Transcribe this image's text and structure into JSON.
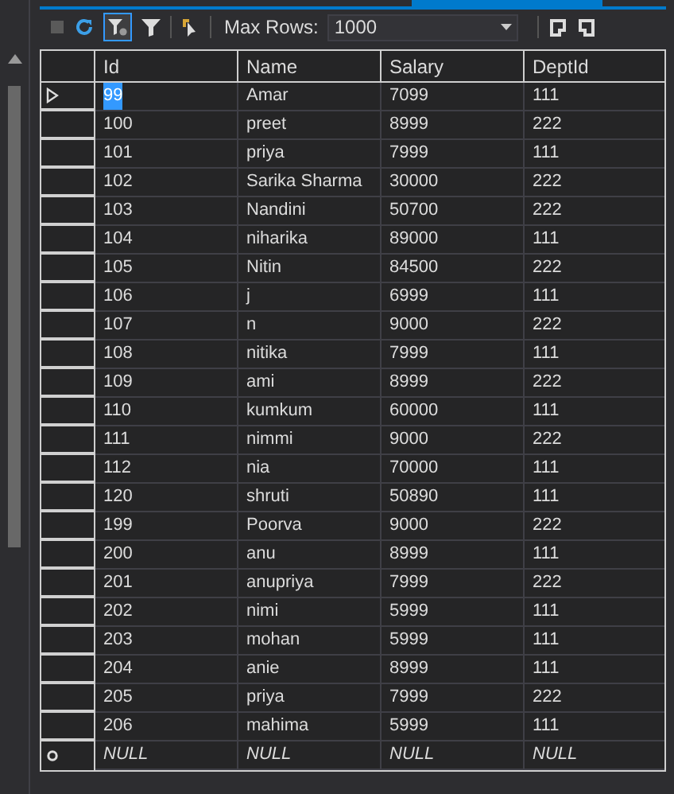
{
  "toolbar": {
    "filter_selected": true,
    "max_rows_label": "Max Rows:",
    "max_rows_value": "1000"
  },
  "table": {
    "columns": [
      "Id",
      "Name",
      "Salary",
      "DeptId"
    ],
    "rows": [
      {
        "kind": "data",
        "current": true,
        "cells": [
          "99",
          "Amar",
          "7099",
          "111"
        ]
      },
      {
        "kind": "data",
        "current": false,
        "cells": [
          "100",
          "preet",
          "8999",
          "222"
        ]
      },
      {
        "kind": "data",
        "current": false,
        "cells": [
          "101",
          "priya",
          "7999",
          "111"
        ]
      },
      {
        "kind": "data",
        "current": false,
        "cells": [
          "102",
          "Sarika Sharma",
          "30000",
          "222"
        ]
      },
      {
        "kind": "data",
        "current": false,
        "cells": [
          "103",
          "Nandini",
          "50700",
          "222"
        ]
      },
      {
        "kind": "data",
        "current": false,
        "cells": [
          "104",
          "niharika",
          "89000",
          "111"
        ]
      },
      {
        "kind": "data",
        "current": false,
        "cells": [
          "105",
          "Nitin",
          "84500",
          "222"
        ]
      },
      {
        "kind": "data",
        "current": false,
        "cells": [
          "106",
          "j",
          "6999",
          "111"
        ]
      },
      {
        "kind": "data",
        "current": false,
        "cells": [
          "107",
          "n",
          "9000",
          "222"
        ]
      },
      {
        "kind": "data",
        "current": false,
        "cells": [
          "108",
          "nitika",
          "7999",
          "111"
        ]
      },
      {
        "kind": "data",
        "current": false,
        "cells": [
          "109",
          "ami",
          "8999",
          "222"
        ]
      },
      {
        "kind": "data",
        "current": false,
        "cells": [
          "110",
          "kumkum",
          "60000",
          "111"
        ]
      },
      {
        "kind": "data",
        "current": false,
        "cells": [
          "111",
          "nimmi",
          "9000",
          "222"
        ]
      },
      {
        "kind": "data",
        "current": false,
        "cells": [
          "112",
          "nia",
          "70000",
          "111"
        ]
      },
      {
        "kind": "data",
        "current": false,
        "cells": [
          "120",
          "shruti",
          "50890",
          "111"
        ]
      },
      {
        "kind": "data",
        "current": false,
        "cells": [
          "199",
          "Poorva",
          "9000",
          "222"
        ]
      },
      {
        "kind": "data",
        "current": false,
        "cells": [
          "200",
          "anu",
          "8999",
          "111"
        ]
      },
      {
        "kind": "data",
        "current": false,
        "cells": [
          "201",
          "anupriya",
          "7999",
          "222"
        ]
      },
      {
        "kind": "data",
        "current": false,
        "cells": [
          "202",
          "nimi",
          "5999",
          "111"
        ]
      },
      {
        "kind": "data",
        "current": false,
        "cells": [
          "203",
          "mohan",
          "5999",
          "111"
        ]
      },
      {
        "kind": "data",
        "current": false,
        "cells": [
          "204",
          "anie",
          "8999",
          "111"
        ]
      },
      {
        "kind": "data",
        "current": false,
        "cells": [
          "205",
          "priya",
          "7999",
          "222"
        ]
      },
      {
        "kind": "data",
        "current": false,
        "cells": [
          "206",
          "mahima",
          "5999",
          "111"
        ]
      },
      {
        "kind": "new",
        "current": false,
        "cells": [
          "NULL",
          "NULL",
          "NULL",
          "NULL"
        ]
      }
    ]
  }
}
